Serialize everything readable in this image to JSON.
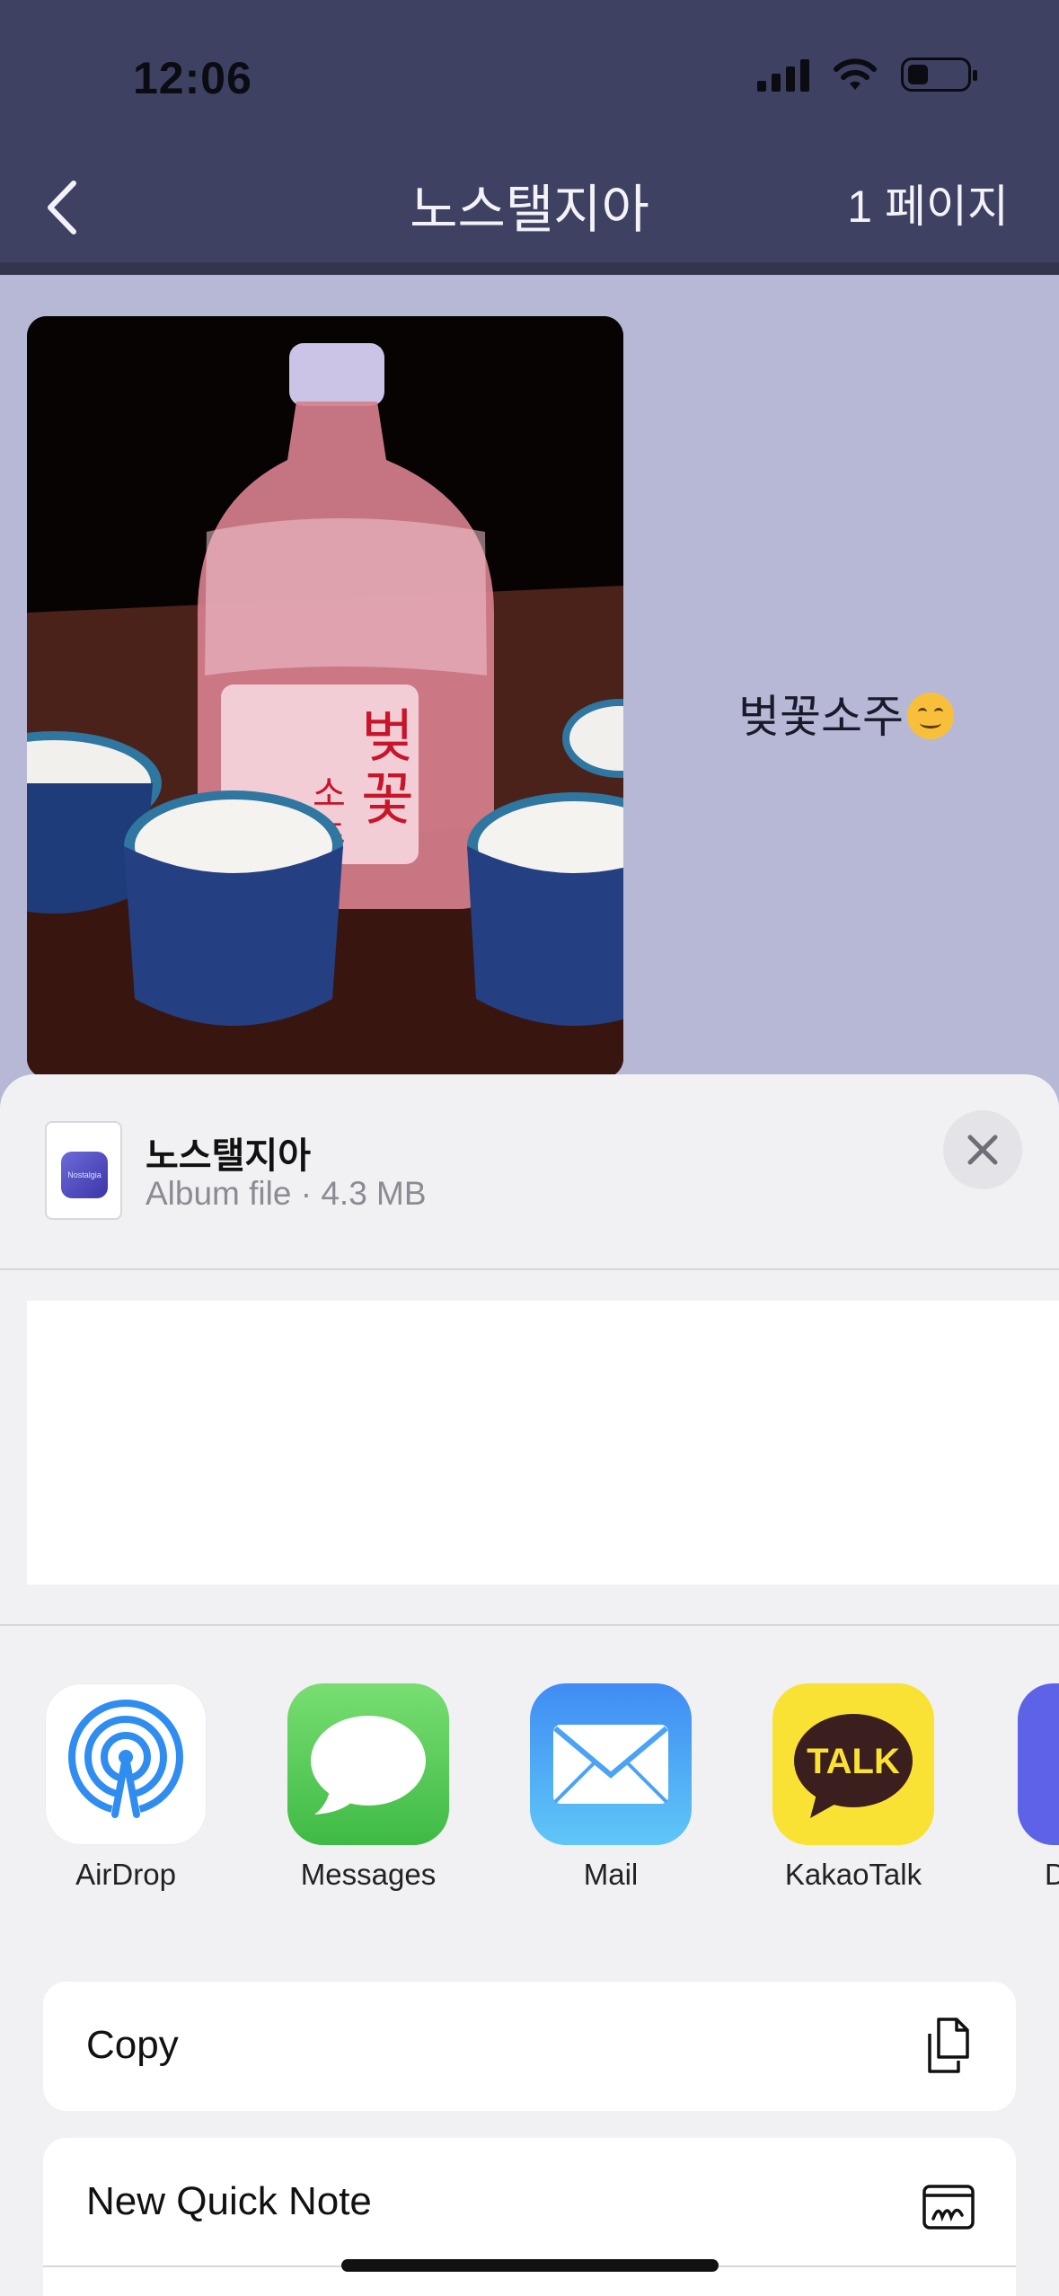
{
  "status_bar": {
    "time": "12:06"
  },
  "nav": {
    "title": "노스탤지아",
    "pages": "1 페이지"
  },
  "album": {
    "caption": "벚꽃소주"
  },
  "share_sheet": {
    "file_name": "노스탤지아",
    "file_meta": "Album file · 4.3 MB",
    "file_icon_text": "Nostalgia",
    "apps": [
      {
        "label": "AirDrop",
        "icon": "airdrop-icon"
      },
      {
        "label": "Messages",
        "icon": "messages-icon"
      },
      {
        "label": "Mail",
        "icon": "mail-icon"
      },
      {
        "label": "KakaoTalk",
        "icon": "kakaotalk-icon"
      },
      {
        "label": "D",
        "icon": "discord-icon"
      }
    ],
    "kakao_badge": "TALK",
    "actions": [
      {
        "label": "Copy",
        "icon": "copy-icon"
      },
      {
        "label": "New Quick Note",
        "icon": "quick-note-icon"
      }
    ]
  },
  "colors": {
    "header": "#3f4163",
    "background": "#b6b8d6",
    "sheet": "#f1f1f4"
  }
}
